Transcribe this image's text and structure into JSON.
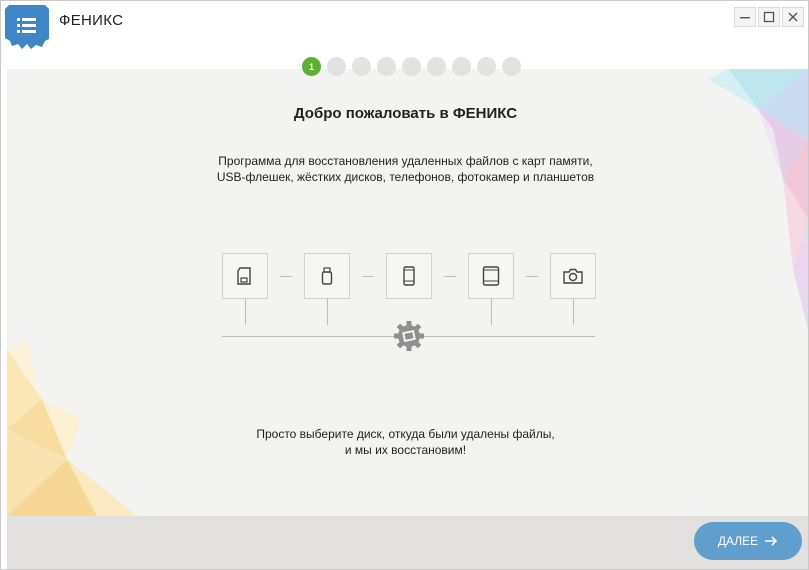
{
  "app": {
    "title": "ФЕНИКС",
    "logo_icon": "menu-gear-icon",
    "accent": "#3f86c7"
  },
  "window_controls": [
    {
      "name": "minimize-button",
      "icon": "minimize-icon"
    },
    {
      "name": "maximize-button",
      "icon": "maximize-icon"
    },
    {
      "name": "close-button",
      "icon": "close-icon"
    }
  ],
  "steps": {
    "current": 1,
    "total": 9,
    "current_label": "1",
    "active_color": "#5ab033"
  },
  "welcome": {
    "heading": "Добро пожаловать в ФЕНИКС",
    "description_line1": "Программа для восстановления удаленных файлов с карт памяти,",
    "description_line2": "USB-флешек, жёстких дисков, телефонов, фотокамер и планшетов"
  },
  "devices": [
    {
      "icon": "memory-card-icon"
    },
    {
      "icon": "usb-flash-icon"
    },
    {
      "icon": "phone-icon"
    },
    {
      "icon": "tablet-icon"
    },
    {
      "icon": "camera-icon"
    }
  ],
  "hub_icon": "recovery-gear-icon",
  "footer": {
    "line1": "Просто выберите диск, откуда были удалены файлы,",
    "line2": "и мы их восстановим!"
  },
  "next_button": {
    "label": "ДАЛЕЕ",
    "icon": "arrow-right-icon",
    "color": "#5f9ecd"
  }
}
